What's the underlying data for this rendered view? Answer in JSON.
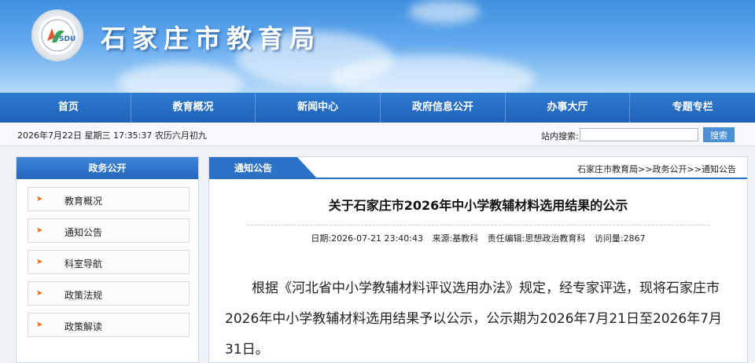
{
  "site": {
    "title": "石家庄市教育局"
  },
  "nav": {
    "items": [
      "首页",
      "教育概况",
      "新闻中心",
      "政府信息公开",
      "办事大厅",
      "专题专栏"
    ]
  },
  "infobar": {
    "datetime": "2026年7月22日 星期三 17:35:37 农历六月初九",
    "search_label": "站内搜索:",
    "search_value": "",
    "search_button": "搜索"
  },
  "sidebar": {
    "heading": "政务公开",
    "items": [
      "教育概况",
      "通知公告",
      "科室导航",
      "政策法规",
      "政策解读"
    ]
  },
  "main": {
    "tab": "通知公告",
    "breadcrumb": "石家庄市教育局>>政务公开>>通知公告",
    "title": "关于石家庄市2026年中小学教辅材料选用结果的公示",
    "meta": {
      "date": "日期:2026-07-21 23:40:43",
      "source": "来源:基教科",
      "editor": "责任编辑:思想政治教育科",
      "views": "访问量:2867"
    },
    "body": "根据《河北省中小学教辅材料评议选用办法》规定，经专家评选，现将石家庄市2026年中小学教辅材料选用结果予以公示，公示期为2026年7月21日至2026年7月31日。"
  },
  "colors": {
    "nav": "#2467bd",
    "accent_arrow": "#e56a1b",
    "banner": "#62a8ee"
  }
}
